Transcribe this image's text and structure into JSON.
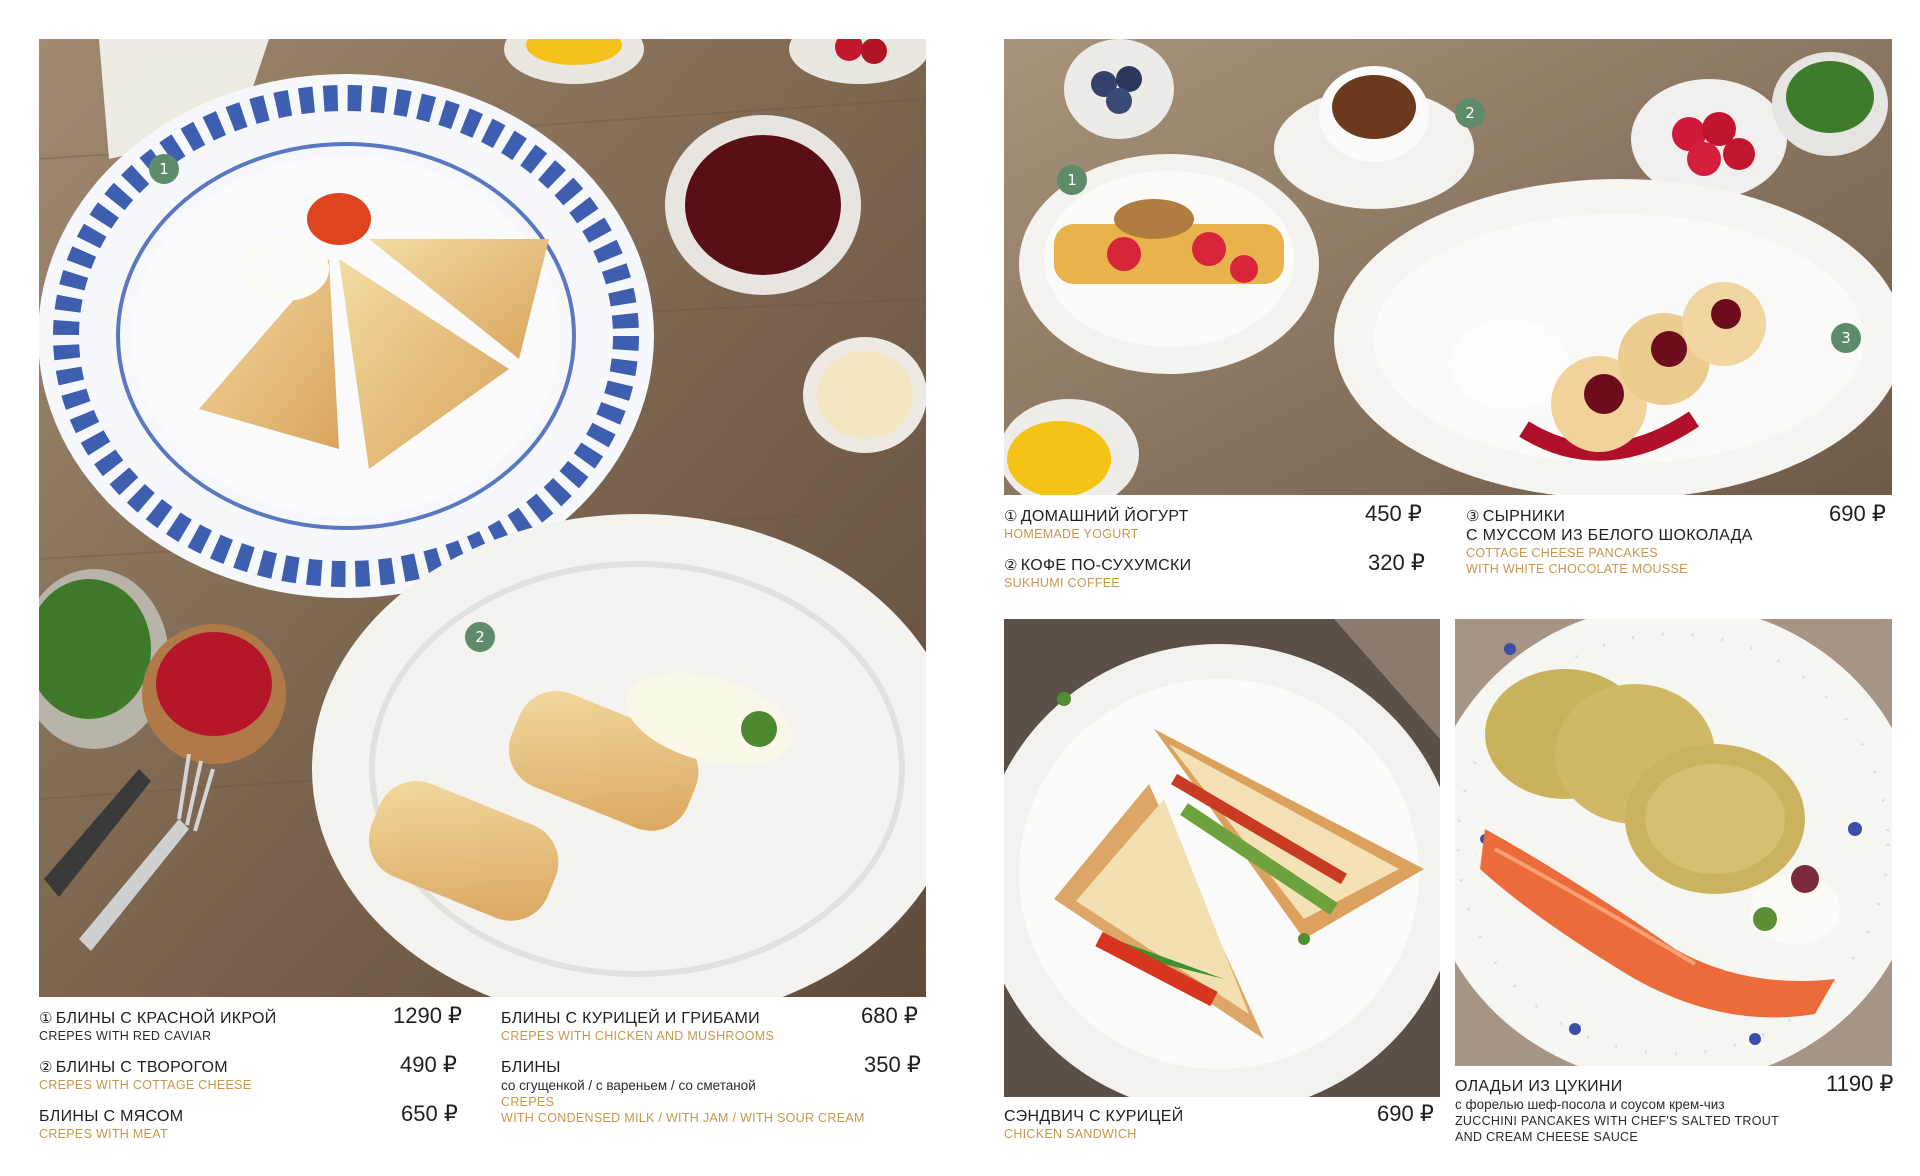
{
  "currency": "₽",
  "colors": {
    "accent_en_text": "#c9964d",
    "badge": "#5e8c6b",
    "text": "#1f1f1f"
  },
  "photos": {
    "crepes": {
      "badges": [
        "1",
        "2"
      ]
    },
    "yogurt_syrniki": {
      "badges": [
        "1",
        "2",
        "3"
      ]
    }
  },
  "left_column_1": [
    {
      "marker": "①",
      "name_ru": "Блины с красной икрой",
      "name_en": "Crepes with red caviar",
      "price": "1290 ₽"
    },
    {
      "marker": "②",
      "name_ru": "Блины с творогом",
      "name_en": "Crepes with cottage cheese",
      "price": "490 ₽"
    },
    {
      "marker": "",
      "name_ru": "Блины с мясом",
      "name_en": "Crepes with meat",
      "price": "650 ₽"
    }
  ],
  "left_column_2": [
    {
      "name_ru": "Блины с курицей и грибами",
      "name_en": "Crepes with chicken and mushrooms",
      "price": "680 ₽"
    },
    {
      "name_ru": "Блины",
      "subtitle_ru": "со сгущенкой / с вареньем / со сметаной",
      "name_en": "Crepes",
      "name_en_2": "with condensed milk / with jam / with sour cream",
      "price": "350 ₽"
    }
  ],
  "right_top_items": [
    {
      "marker": "①",
      "name_ru": "Домашний йогурт",
      "name_en": "Homemade yogurt",
      "price": "450 ₽"
    },
    {
      "marker": "②",
      "name_ru": "Кофе по-сухумски",
      "name_en": "Sukhumi coffee",
      "price": "320 ₽"
    },
    {
      "marker": "③",
      "name_ru": "Сырники",
      "name_ru_2": "с муссом из белого шоколада",
      "name_en": "Cottage cheese pancakes",
      "name_en_2": "with white chocolate mousse",
      "price": "690 ₽"
    }
  ],
  "sandwich": {
    "name_ru": "Сэндвич с курицей",
    "name_en": "Chicken sandwich",
    "price": "690 ₽"
  },
  "zucchini": {
    "name_ru": "Оладьи из цукини",
    "subtitle_ru": "с форелью шеф-посола и соусом крем-чиз",
    "name_en": "Zucchini pancakes with chef's salted trout",
    "name_en_2": "and cream cheese sauce",
    "price": "1190 ₽"
  }
}
